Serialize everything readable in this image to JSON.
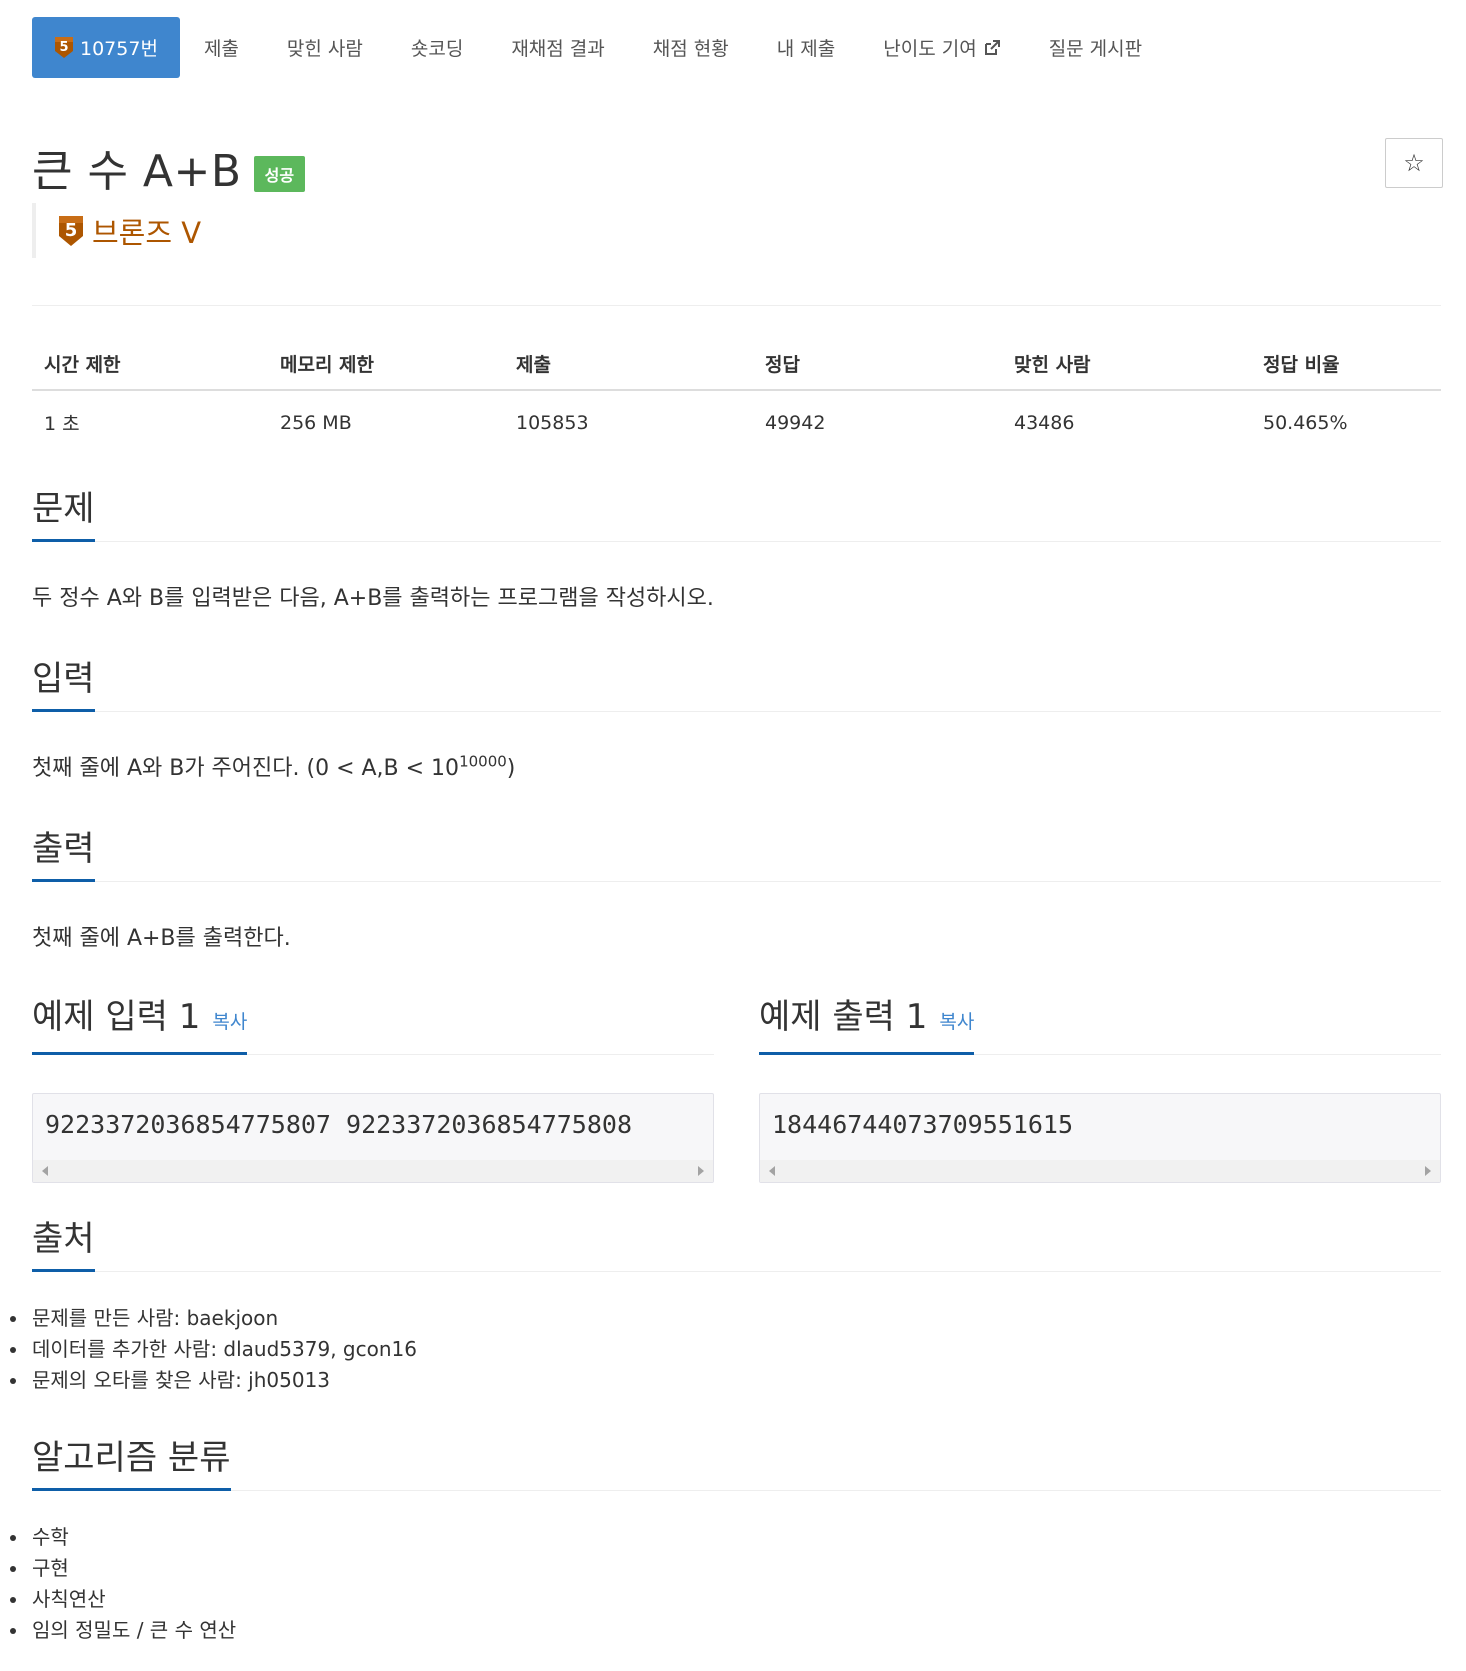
{
  "tabs": [
    {
      "label": "10757번",
      "active": true
    },
    {
      "label": "제출"
    },
    {
      "label": "맞힌 사람"
    },
    {
      "label": "숏코딩"
    },
    {
      "label": "재채점 결과"
    },
    {
      "label": "채점 현황"
    },
    {
      "label": "내 제출"
    },
    {
      "label": "난이도 기여"
    },
    {
      "label": "질문 게시판"
    }
  ],
  "problem": {
    "title": "큰 수 A+B",
    "status_badge": "성공",
    "tier_number": "5",
    "tier_label": "브론즈 V",
    "tier_color": "#ad5600",
    "star_icon": "☆"
  },
  "info": {
    "headers": [
      "시간 제한",
      "메모리 제한",
      "제출",
      "정답",
      "맞힌 사람",
      "정답 비율"
    ],
    "values": [
      "1 초",
      "256 MB",
      "105853",
      "49942",
      "43486",
      "50.465%"
    ]
  },
  "sections": {
    "problem_title": "문제",
    "problem_text": "두 정수 A와 B를 입력받은 다음, A+B를 출력하는 프로그램을 작성하시오.",
    "input_title": "입력",
    "input_text_pre": "첫째 줄에 A와 B가 주어진다. (0 < A,B < 10",
    "input_text_sup": "10000",
    "input_text_post": ")",
    "output_title": "출력",
    "output_text": "첫째 줄에 A+B를 출력한다.",
    "sample_input_title": "예제 입력 1",
    "sample_output_title": "예제 출력 1",
    "copy_label": "복사",
    "sample_input": "9223372036854775807 9223372036854775808",
    "sample_output": "18446744073709551615",
    "source_title": "출처",
    "source_items": [
      "문제를 만든 사람: baekjoon",
      "데이터를 추가한 사람: dlaud5379, gcon16",
      "문제의 오타를 찾은 사람: jh05013"
    ],
    "algo_title": "알고리즘 분류",
    "algo_items": [
      "수학",
      "구현",
      "사칙연산",
      "임의 정밀도 / 큰 수 연산"
    ]
  },
  "colors": {
    "accent": "#3f86ce",
    "section_underline": "#0e5ea8",
    "success": "#5cb85c",
    "bronze": "#ad5600"
  }
}
